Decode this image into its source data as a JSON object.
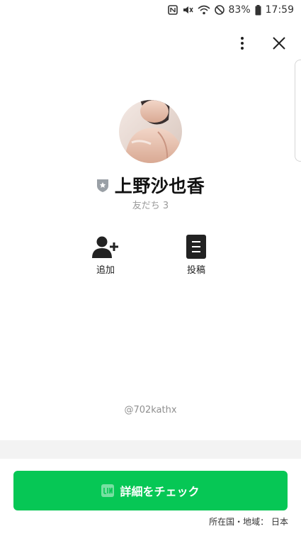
{
  "status_bar": {
    "battery": "83%",
    "time": "17:59",
    "icons": [
      "nfc-icon",
      "vibrate-off-icon",
      "wifi-icon",
      "do-not-disturb-icon",
      "battery-icon"
    ]
  },
  "header": {
    "more_icon": "more-vertical-icon",
    "close_icon": "close-icon"
  },
  "profile": {
    "name": "上野沙也香",
    "friends": "友だち 3",
    "handle": "@702kathx",
    "badge_icon": "shield-badge-icon"
  },
  "actions": [
    {
      "label": "追加",
      "icon": "add-friend-icon"
    },
    {
      "label": "投稿",
      "icon": "posts-icon"
    }
  ],
  "cta": {
    "label": "詳細をチェック",
    "icon": "line-icon",
    "color": "#06c755"
  },
  "footer": {
    "region": "所在国・地域： 日本"
  }
}
